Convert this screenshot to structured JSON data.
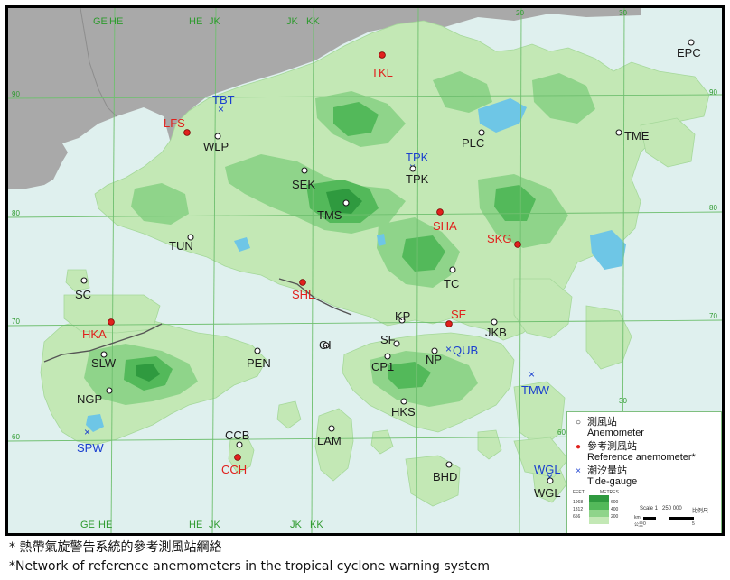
{
  "grid_labels_top": [
    "GE",
    "HE",
    "HE",
    "JK",
    "JK",
    "KK"
  ],
  "grid_labels_bottom": [
    "GE",
    "HE",
    "HE",
    "JK",
    "JK",
    "KK"
  ],
  "grid_numbers": [
    "90",
    "80",
    "70",
    "60",
    "90",
    "80",
    "70",
    "60",
    "20",
    "30",
    "30"
  ],
  "stations": [
    {
      "code": "EPC",
      "type": "anemometer"
    },
    {
      "code": "TKL",
      "type": "reference"
    },
    {
      "code": "TBT",
      "type": "tide"
    },
    {
      "code": "LFS",
      "type": "reference"
    },
    {
      "code": "WLP",
      "type": "anemometer"
    },
    {
      "code": "TME",
      "type": "anemometer"
    },
    {
      "code": "PLC",
      "type": "anemometer"
    },
    {
      "code": "TPK",
      "type": "tide"
    },
    {
      "code": "TPK",
      "type": "anemometer"
    },
    {
      "code": "SEK",
      "type": "anemometer"
    },
    {
      "code": "TMS",
      "type": "anemometer"
    },
    {
      "code": "SHA",
      "type": "reference"
    },
    {
      "code": "SKG",
      "type": "reference"
    },
    {
      "code": "TUN",
      "type": "anemometer"
    },
    {
      "code": "SC",
      "type": "anemometer"
    },
    {
      "code": "SHL",
      "type": "reference"
    },
    {
      "code": "TC",
      "type": "anemometer"
    },
    {
      "code": "HKA",
      "type": "reference"
    },
    {
      "code": "KP",
      "type": "anemometer"
    },
    {
      "code": "SE",
      "type": "reference"
    },
    {
      "code": "JKB",
      "type": "anemometer"
    },
    {
      "code": "SF",
      "type": "anemometer"
    },
    {
      "code": "GI",
      "type": "anemometer"
    },
    {
      "code": "SLW",
      "type": "anemometer"
    },
    {
      "code": "PEN",
      "type": "anemometer"
    },
    {
      "code": "CP1",
      "type": "anemometer"
    },
    {
      "code": "NP",
      "type": "anemometer"
    },
    {
      "code": "QUB",
      "type": "tide"
    },
    {
      "code": "NGP",
      "type": "anemometer"
    },
    {
      "code": "TMW",
      "type": "tide"
    },
    {
      "code": "HKS",
      "type": "anemometer"
    },
    {
      "code": "SPW",
      "type": "tide"
    },
    {
      "code": "CCB",
      "type": "anemometer"
    },
    {
      "code": "LAM",
      "type": "anemometer"
    },
    {
      "code": "CCH",
      "type": "reference"
    },
    {
      "code": "WGL",
      "type": "tide"
    },
    {
      "code": "WGL",
      "type": "anemometer"
    },
    {
      "code": "BHD",
      "type": "anemometer"
    }
  ],
  "legend": {
    "anemometer_zh": "測風站",
    "anemometer_en": "Anemometer",
    "reference_zh": "參考測風站",
    "reference_en": "Reference anemometer*",
    "tide_zh": "潮汐量站",
    "tide_en": "Tide-gauge",
    "elev_feet_label": "FEET",
    "elev_metres_label": "METRES",
    "elev_feet_values": [
      "1968",
      "1312",
      "656"
    ],
    "elev_metre_values": [
      "600",
      "400",
      "200"
    ],
    "scale_text": "Scale 1 : 250 000",
    "scale_zh": "比例尺",
    "scale_units": [
      "km",
      "公里",
      "0",
      "5"
    ]
  },
  "colors": {
    "sea": "#dff0ee",
    "land_low": "#c3e8b5",
    "land_mid": "#8fd48a",
    "land_high": "#53b95a",
    "land_peak": "#2f9a3f",
    "mainland": "#a9a9a9",
    "reservoir": "#6ec6e6",
    "anemometer": "#1a1a1a",
    "reference": "#e0211d",
    "tide": "#1a3fcf"
  },
  "footnotes": {
    "zh": "* 熱帶氣旋警告系統的參考測風站網絡",
    "en": "*Network of reference anemometers in the tropical cyclone warning system"
  }
}
